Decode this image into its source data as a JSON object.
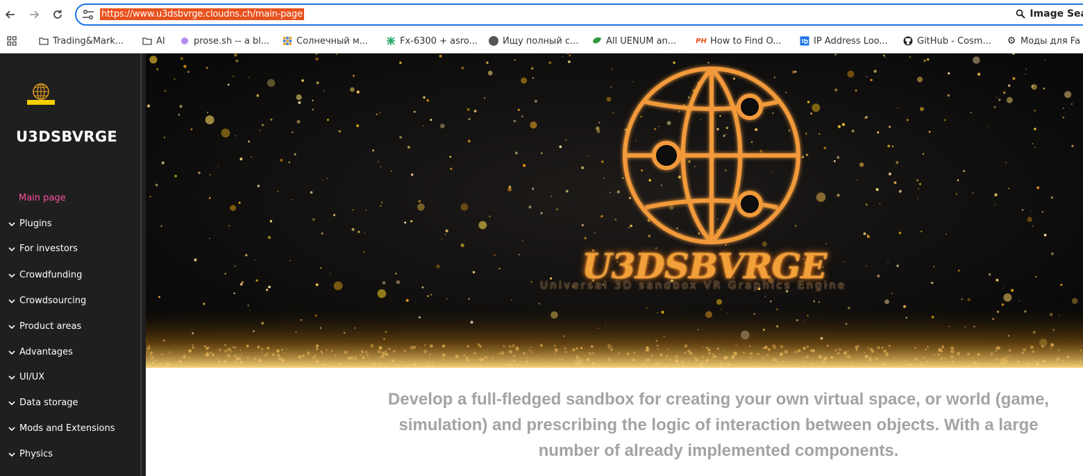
{
  "browser": {
    "url": "https://www.u3dsbvrge.cloudns.ch/main-page",
    "omnibox_action": "Image Sea"
  },
  "bookmarks": [
    {
      "label": "Trading&Mark...",
      "icon": "folder-icon"
    },
    {
      "label": "AI",
      "icon": "folder-icon"
    },
    {
      "label": "prose.sh -- a bl...",
      "icon": "purple-dot-icon"
    },
    {
      "label": "Солнечный м...",
      "icon": "grid-icon"
    },
    {
      "label": "Fx-6300 + asro...",
      "icon": "green-cross-icon"
    },
    {
      "label": "Ищу полный с...",
      "icon": "forum-icon"
    },
    {
      "label": "All UENUM an...",
      "icon": "leaf-icon"
    },
    {
      "label": "How to Find O...",
      "icon": "ph-icon"
    },
    {
      "label": "IP Address Loo...",
      "icon": "ip-icon"
    },
    {
      "label": "GitHub - Cosm...",
      "icon": "github-icon"
    },
    {
      "label": "Моды для Fa",
      "icon": "gear-icon"
    }
  ],
  "sidebar": {
    "logo_text": "U3DSBVRGE",
    "title": "U3DSBVRGE",
    "items": [
      {
        "label": "Main page",
        "active": true
      },
      {
        "label": "Plugins"
      },
      {
        "label": "For investors"
      },
      {
        "label": "Crowdfunding"
      },
      {
        "label": "Crowdsourcing"
      },
      {
        "label": "Product areas"
      },
      {
        "label": "Advantages"
      },
      {
        "label": "UI/UX"
      },
      {
        "label": "Data storage"
      },
      {
        "label": "Mods and Extensions"
      },
      {
        "label": "Physics"
      }
    ]
  },
  "hero": {
    "title": "U3DSBVRGE",
    "subtitle": "Universal 3D sandbox VR Graphics Engine"
  },
  "description": "Develop a full-fledged sandbox for creating your own virtual space, or world (game, simulation) and prescribing the logic of interaction between objects. With a large number of already implemented components.",
  "colors": {
    "accent_active": "#ff4fa0",
    "sidebar_bg": "#1f1f1f",
    "hero_orange": "#f2a03a",
    "url_highlight": "#e8501c"
  }
}
